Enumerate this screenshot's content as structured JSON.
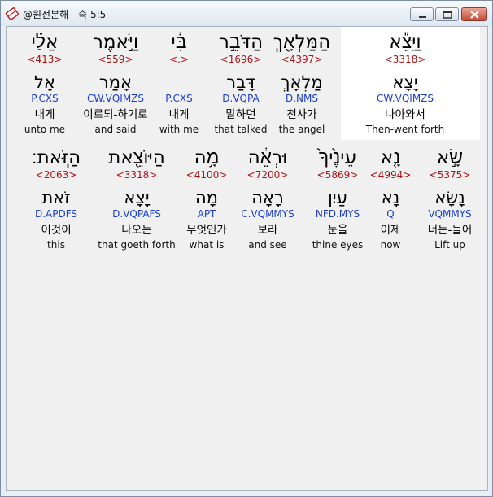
{
  "window": {
    "title": "@원전분해 - 슥 5:5",
    "controls": [
      "minimize",
      "maximize",
      "close"
    ]
  },
  "row1": [
    {
      "heb": "אֵלַ֗י",
      "strong": "<413>",
      "root": "אֵל",
      "morph": "P.CXS",
      "kor": "내게",
      "eng": "unto me"
    },
    {
      "heb": "וַיֹּ֣אמֶר",
      "strong": "<559>",
      "root": "אָמַר",
      "morph": "CW.VQIMZS",
      "kor": "이르되-하기로",
      "eng": "and said"
    },
    {
      "heb": "בִּ֔י",
      "strong": "<.>",
      "root": "",
      "morph": "P.CXS",
      "kor": "내게",
      "eng": "with me"
    },
    {
      "heb": "הַדֹּבֵ֣ר",
      "strong": "<1696>",
      "root": "דָּבַר",
      "morph": "D.VQPA",
      "kor": "말하던",
      "eng": "that talked"
    },
    {
      "heb": "הַמַּלְאָ֖ךְ",
      "strong": "<4397>",
      "root": "מַלְאָךְ",
      "morph": "D.NMS",
      "kor": "천사가",
      "eng": "the angel"
    },
    {
      "heb": "וַיֵּצֵ֕א",
      "strong": "<3318>",
      "root": "יָצָא",
      "morph": "CW.VQIMZS",
      "kor": "나아와서",
      "eng": "Then-went forth",
      "highlight": true
    }
  ],
  "row2": [
    {
      "heb": "הַזֹּֽאת׃",
      "strong": "<2063>",
      "root": "זֹאת",
      "morph": "D.APDFS",
      "kor": "이것이",
      "eng": "this"
    },
    {
      "heb": "הַיּוֹצֵ֖את",
      "strong": "<3318>",
      "root": "יָצָא",
      "morph": "D.VQPAFS",
      "kor": "나오는",
      "eng": "that goeth forth"
    },
    {
      "heb": "מָ֥ה",
      "strong": "<4100>",
      "root": "מָה",
      "morph": "APT",
      "kor": "무엇인가",
      "eng": "what is"
    },
    {
      "heb": "וּרְאֵ֔ה",
      "strong": "<7200>",
      "root": "רָאָה",
      "morph": "C.VQMMYS",
      "kor": "보라",
      "eng": "and see"
    },
    {
      "heb": "עֵינֶ֙יךָ֙",
      "strong": "<5869>",
      "root": "עַיִן",
      "morph": "NFD.MYS",
      "kor": "눈을",
      "eng": "thine eyes"
    },
    {
      "heb": "נָ֤א",
      "strong": "<4994>",
      "root": "נָא",
      "morph": "Q",
      "kor": "이제",
      "eng": "now"
    },
    {
      "heb": "שָׂ֣א",
      "strong": "<5375>",
      "root": "נָשָׂא",
      "morph": "VQMMYS",
      "kor": "너는-들어",
      "eng": "Lift up"
    }
  ]
}
